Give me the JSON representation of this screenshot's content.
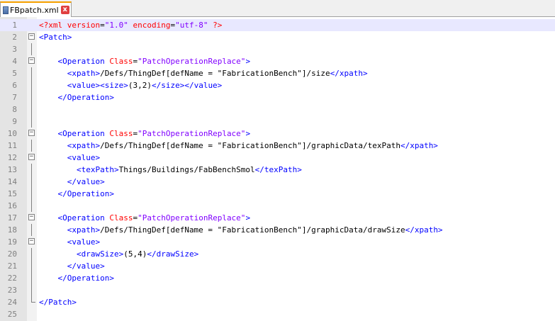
{
  "tab": {
    "label": "FBpatch.xml",
    "close_glyph": "x"
  },
  "colors": {
    "tag": "#0000ff",
    "attr": "#ff0000",
    "value": "#8000ff",
    "text": "#000000",
    "current_line": "#e8e8ff"
  },
  "lines": [
    {
      "num": "1",
      "fold": "",
      "current": true,
      "segs": [
        [
          "pi",
          "<?xml "
        ],
        [
          "attr",
          "version"
        ],
        [
          "txt",
          "="
        ],
        [
          "val",
          "\"1.0\""
        ],
        [
          "txt",
          " "
        ],
        [
          "attr",
          "encoding"
        ],
        [
          "txt",
          "="
        ],
        [
          "val",
          "\"utf-8\""
        ],
        [
          "pi",
          " ?>"
        ]
      ]
    },
    {
      "num": "2",
      "fold": "minus",
      "segs": [
        [
          "tag",
          "<Patch>"
        ]
      ]
    },
    {
      "num": "3",
      "fold": "line",
      "segs": []
    },
    {
      "num": "4",
      "fold": "minus",
      "segs": [
        [
          "txt",
          "    "
        ],
        [
          "tag",
          "<Operation "
        ],
        [
          "attr",
          "Class"
        ],
        [
          "txt",
          "="
        ],
        [
          "val",
          "\"PatchOperationReplace\""
        ],
        [
          "tag",
          ">"
        ]
      ]
    },
    {
      "num": "5",
      "fold": "line",
      "segs": [
        [
          "txt",
          "      "
        ],
        [
          "tag",
          "<xpath>"
        ],
        [
          "txt",
          "/Defs/ThingDef[defName = \"FabricationBench\"]/size"
        ],
        [
          "tag",
          "</xpath>"
        ]
      ]
    },
    {
      "num": "6",
      "fold": "line",
      "segs": [
        [
          "txt",
          "      "
        ],
        [
          "tag",
          "<value><size>"
        ],
        [
          "txt",
          "(3,2)"
        ],
        [
          "tag",
          "</size></value>"
        ]
      ]
    },
    {
      "num": "7",
      "fold": "line",
      "segs": [
        [
          "txt",
          "    "
        ],
        [
          "tag",
          "</Operation>"
        ]
      ]
    },
    {
      "num": "8",
      "fold": "line",
      "segs": []
    },
    {
      "num": "9",
      "fold": "line",
      "segs": []
    },
    {
      "num": "10",
      "fold": "minus",
      "segs": [
        [
          "txt",
          "    "
        ],
        [
          "tag",
          "<Operation "
        ],
        [
          "attr",
          "Class"
        ],
        [
          "txt",
          "="
        ],
        [
          "val",
          "\"PatchOperationReplace\""
        ],
        [
          "tag",
          ">"
        ]
      ]
    },
    {
      "num": "11",
      "fold": "line",
      "segs": [
        [
          "txt",
          "      "
        ],
        [
          "tag",
          "<xpath>"
        ],
        [
          "txt",
          "/Defs/ThingDef[defName = \"FabricationBench\"]/graphicData/texPath"
        ],
        [
          "tag",
          "</xpath>"
        ]
      ]
    },
    {
      "num": "12",
      "fold": "minus",
      "segs": [
        [
          "txt",
          "      "
        ],
        [
          "tag",
          "<value>"
        ]
      ]
    },
    {
      "num": "13",
      "fold": "line",
      "segs": [
        [
          "txt",
          "        "
        ],
        [
          "tag",
          "<texPath>"
        ],
        [
          "txt",
          "Things/Buildings/FabBenchSmol"
        ],
        [
          "tag",
          "</texPath>"
        ]
      ]
    },
    {
      "num": "14",
      "fold": "line",
      "segs": [
        [
          "txt",
          "      "
        ],
        [
          "tag",
          "</value>"
        ]
      ]
    },
    {
      "num": "15",
      "fold": "line",
      "segs": [
        [
          "txt",
          "    "
        ],
        [
          "tag",
          "</Operation>"
        ]
      ]
    },
    {
      "num": "16",
      "fold": "line",
      "segs": []
    },
    {
      "num": "17",
      "fold": "minus",
      "segs": [
        [
          "txt",
          "    "
        ],
        [
          "tag",
          "<Operation "
        ],
        [
          "attr",
          "Class"
        ],
        [
          "txt",
          "="
        ],
        [
          "val",
          "\"PatchOperationReplace\""
        ],
        [
          "tag",
          ">"
        ]
      ]
    },
    {
      "num": "18",
      "fold": "line",
      "segs": [
        [
          "txt",
          "      "
        ],
        [
          "tag",
          "<xpath>"
        ],
        [
          "txt",
          "/Defs/ThingDef[defName = \"FabricationBench\"]/graphicData/drawSize"
        ],
        [
          "tag",
          "</xpath>"
        ]
      ]
    },
    {
      "num": "19",
      "fold": "minus",
      "segs": [
        [
          "txt",
          "      "
        ],
        [
          "tag",
          "<value>"
        ]
      ]
    },
    {
      "num": "20",
      "fold": "line",
      "segs": [
        [
          "txt",
          "        "
        ],
        [
          "tag",
          "<drawSize>"
        ],
        [
          "txt",
          "(5,4)"
        ],
        [
          "tag",
          "</drawSize>"
        ]
      ]
    },
    {
      "num": "21",
      "fold": "line",
      "segs": [
        [
          "txt",
          "      "
        ],
        [
          "tag",
          "</value>"
        ]
      ]
    },
    {
      "num": "22",
      "fold": "line",
      "segs": [
        [
          "txt",
          "    "
        ],
        [
          "tag",
          "</Operation>"
        ]
      ]
    },
    {
      "num": "23",
      "fold": "line",
      "segs": []
    },
    {
      "num": "24",
      "fold": "end",
      "segs": [
        [
          "tag",
          "</Patch>"
        ]
      ]
    },
    {
      "num": "25",
      "fold": "",
      "segs": []
    }
  ]
}
